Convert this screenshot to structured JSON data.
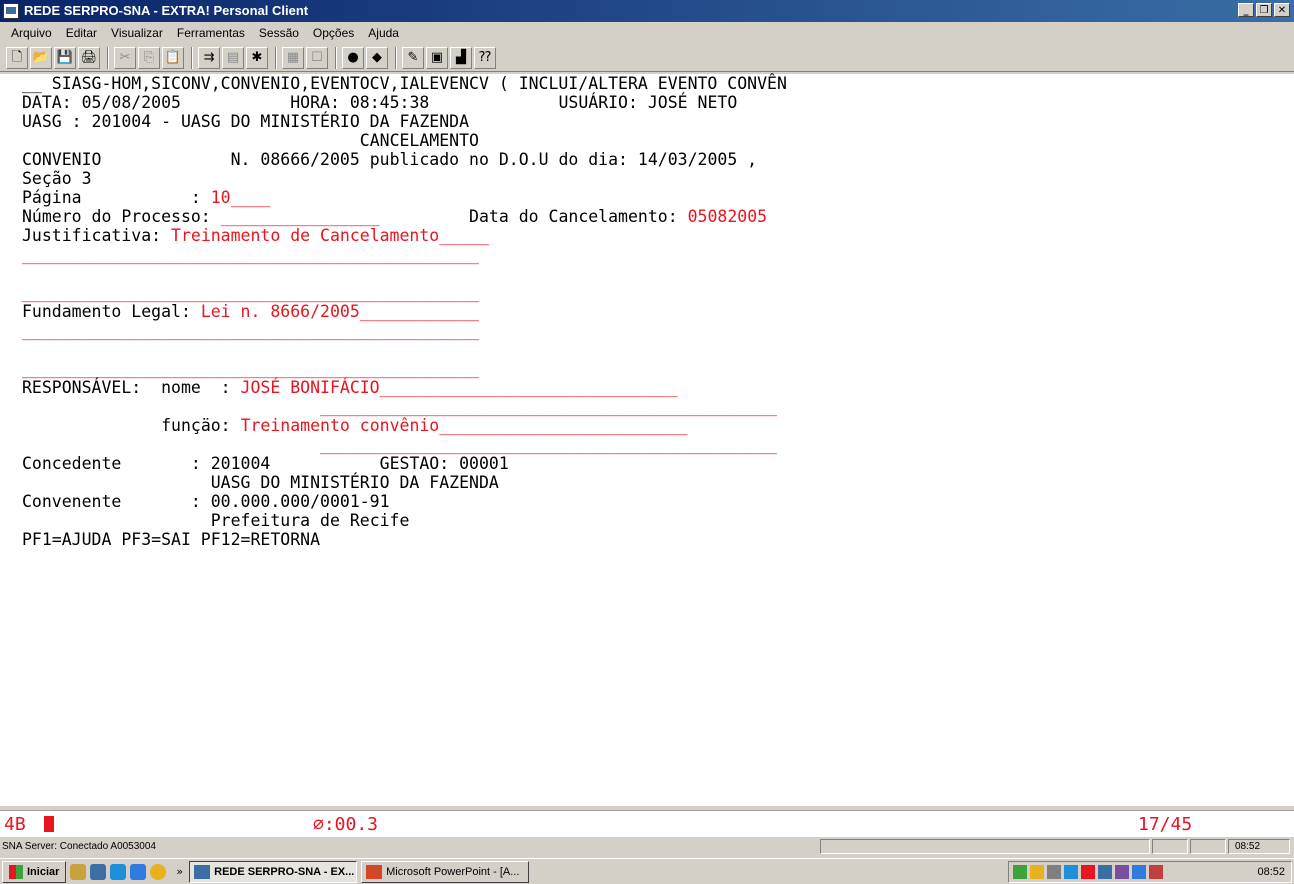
{
  "window": {
    "title": "REDE SERPRO-SNA - EXTRA! Personal Client"
  },
  "menu": [
    "Arquivo",
    "Editar",
    "Visualizar",
    "Ferramentas",
    "Sessão",
    "Opções",
    "Ajuda"
  ],
  "toolbar": [
    {
      "name": "new-icon",
      "glyph": "🗋",
      "enabled": true
    },
    {
      "name": "open-icon",
      "glyph": "📂",
      "enabled": true
    },
    {
      "name": "save-icon",
      "glyph": "💾",
      "enabled": true
    },
    {
      "name": "print-icon",
      "glyph": "🖨",
      "enabled": true
    },
    {
      "sep": true
    },
    {
      "name": "cut-icon",
      "glyph": "✂",
      "enabled": false
    },
    {
      "name": "copy-icon",
      "glyph": "⎘",
      "enabled": false
    },
    {
      "name": "paste-icon",
      "glyph": "📋",
      "enabled": false
    },
    {
      "sep": true
    },
    {
      "name": "transfer-icon",
      "glyph": "⇉",
      "enabled": true
    },
    {
      "name": "screen-icon",
      "glyph": "▤",
      "enabled": false
    },
    {
      "name": "macro-icon",
      "glyph": "✱",
      "enabled": true
    },
    {
      "sep": true
    },
    {
      "name": "display-icon",
      "glyph": "▦",
      "enabled": false
    },
    {
      "name": "connect-icon",
      "glyph": "☐",
      "enabled": false
    },
    {
      "sep": true
    },
    {
      "name": "record-icon",
      "glyph": "●",
      "enabled": true
    },
    {
      "name": "stop-icon",
      "glyph": "◆",
      "enabled": true
    },
    {
      "sep": true
    },
    {
      "name": "edit-icon",
      "glyph": "✎",
      "enabled": true
    },
    {
      "name": "settings-icon",
      "glyph": "▣",
      "enabled": true
    },
    {
      "name": "chart-icon",
      "glyph": "▟",
      "enabled": true
    },
    {
      "name": "help-icon",
      "glyph": "⁇",
      "enabled": true
    }
  ],
  "screen": {
    "header_line": "__ SIASG-HOM,SICONV,CONVENIO,EVENTOCV,IALEVENCV ( INCLUI/ALTERA EVENTO CONVÊN",
    "data_label": "DATA: 05/08/2005",
    "hora_label": "HORA: 08:45:38",
    "usuario_label": "USUÁRIO: JOSÉ NETO",
    "uasg_line": "UASG : 201004 - UASG DO MINISTÉRIO DA FAZENDA",
    "section_title": "CANCELAMENTO",
    "convenio_label": "CONVENIO",
    "convenio_text": "N. 08666/2005 publicado no D.O.U do dia: 14/03/2005 ,",
    "secao_line": "Seção 3",
    "pagina_label": "Página           : ",
    "pagina_value": "10____",
    "processo_label": "Número do Processo: ",
    "processo_value": "________________",
    "data_canc_label": "Data do Cancelamento: ",
    "data_canc_value": "05082005",
    "justificativa_label": "Justificativa: ",
    "justificativa_value": "Treinamento de Cancelamento_____",
    "blank_line": "______________________________________________",
    "fundamento_label": "Fundamento Legal: ",
    "fundamento_value": "Lei n. 8666/2005____________",
    "responsavel_label": "RESPONSÁVEL:  nome  : ",
    "responsavel_value": "JOSÉ BONIFÁCIO______________________________",
    "resp_blank": "______________________________________________",
    "funcao_label": "funçäo: ",
    "funcao_value": "Treinamento convênio_________________________",
    "concedente_label": "Concedente       : 201004",
    "gestao_label": "GESTAO: 00001",
    "concedente_name": "UASG DO MINISTÉRIO DA FAZENDA",
    "convenente_label": "Convenente       : 00.000.000/0001-91",
    "convenente_name": "Prefeitura de Recife",
    "pf_keys": "PF1=AJUDA PF3=SAI PF12=RETORNA"
  },
  "oia": {
    "left": "4B",
    "mid": "⌀:00.3",
    "cursor_pos": "17/45"
  },
  "status": {
    "text": "SNA Server: Conectado A0053004",
    "clock": "08:52"
  },
  "taskbar": {
    "start_label": "Iniciar",
    "chevron": "»",
    "tasks": [
      "REDE SERPRO-SNA - EX...",
      "Microsoft PowerPoint - [A..."
    ],
    "clock": "08:52"
  },
  "colors": {
    "field_red": "#e8141e",
    "title_blue": "#0a246a",
    "face": "#d4d0c8"
  }
}
